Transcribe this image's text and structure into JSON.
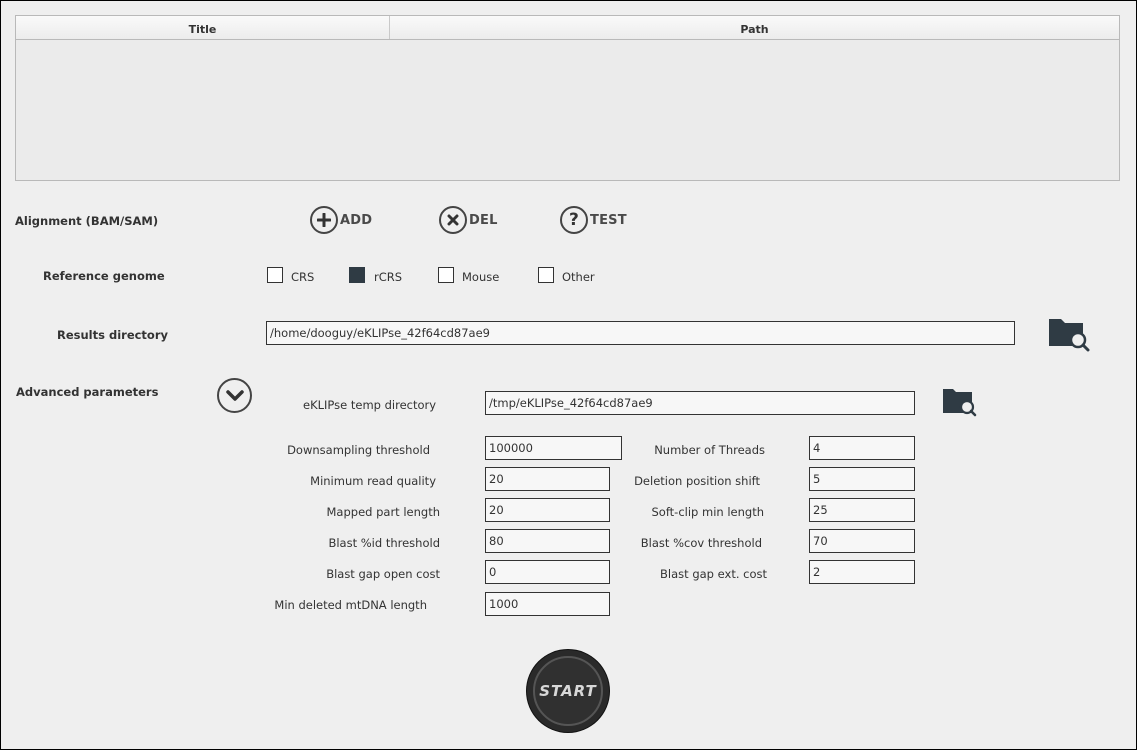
{
  "table": {
    "columns": [
      "Title",
      "Path"
    ]
  },
  "alignment": {
    "label": "Alignment (BAM/SAM)",
    "add_label": "ADD",
    "del_label": "DEL",
    "test_label": "TEST"
  },
  "reference": {
    "label": "Reference genome",
    "options": [
      {
        "label": "CRS",
        "checked": false
      },
      {
        "label": "rCRS",
        "checked": true
      },
      {
        "label": "Mouse",
        "checked": false
      },
      {
        "label": "Other",
        "checked": false
      }
    ]
  },
  "results": {
    "label": "Results directory",
    "value": "/home/dooguy/eKLIPse_42f64cd87ae9"
  },
  "advanced": {
    "label": "Advanced parameters",
    "temp_dir_label": "eKLIPse temp directory",
    "temp_dir_value": "/tmp/eKLIPse_42f64cd87ae9",
    "params_left": [
      {
        "label": "Downsampling threshold",
        "value": "100000"
      },
      {
        "label": "Minimum read quality",
        "value": "20"
      },
      {
        "label": "Mapped part length",
        "value": "20"
      },
      {
        "label": "Blast %id threshold",
        "value": "80"
      },
      {
        "label": "Blast gap open cost",
        "value": "0"
      },
      {
        "label": "Min deleted mtDNA length",
        "value": "1000"
      }
    ],
    "params_right": [
      {
        "label": "Number of Threads",
        "value": "4"
      },
      {
        "label": "Deletion position shift",
        "value": "5"
      },
      {
        "label": "Soft-clip min length",
        "value": "25"
      },
      {
        "label": "Blast %cov threshold",
        "value": "70"
      },
      {
        "label": "Blast gap ext. cost",
        "value": "2"
      }
    ]
  },
  "start": {
    "label": "START"
  },
  "colors": {
    "background": "#efefef",
    "checked": "#2f3b44",
    "folder_icon": "#2f3b44"
  }
}
